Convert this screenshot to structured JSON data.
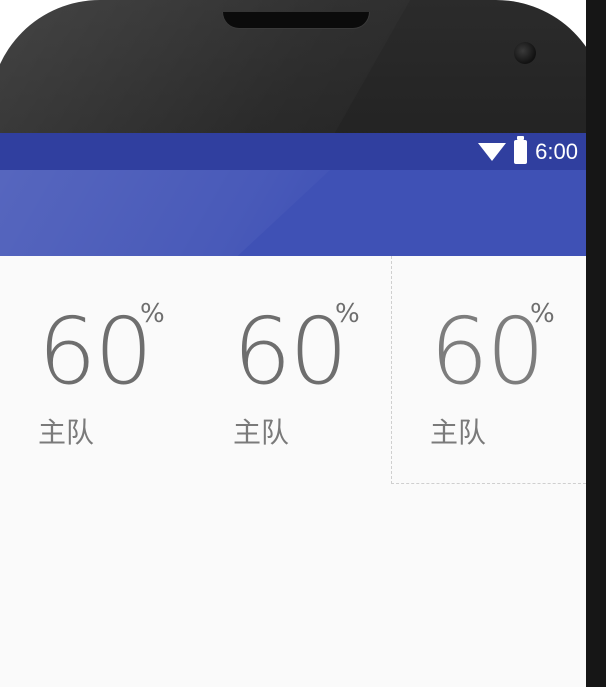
{
  "status_bar": {
    "time": "6:00",
    "icons": [
      "wifi-icon",
      "battery-icon"
    ]
  },
  "toolbar": {
    "title": ""
  },
  "stats": [
    {
      "value": "60",
      "unit": "%",
      "label": "主队"
    },
    {
      "value": "60",
      "unit": "%",
      "label": "主队"
    },
    {
      "value": "60",
      "unit": "%",
      "label": "主队"
    }
  ],
  "colors": {
    "status_bar": "#303f9f",
    "toolbar": "#3f51b5",
    "background": "#fafafa",
    "text": "#6e6e6e"
  }
}
